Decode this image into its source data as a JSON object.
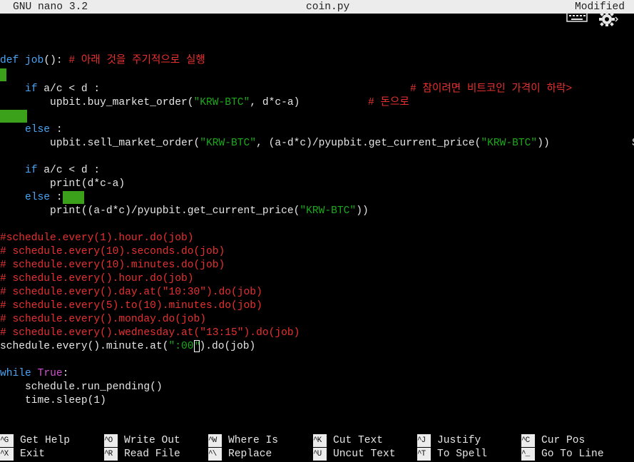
{
  "titlebar": {
    "app": "GNU nano 3.2",
    "file": "coin.py",
    "status": "Modified"
  },
  "tray_icons": [
    "keyboard-icon",
    "gear-icon"
  ],
  "code": {
    "l1_kw": "def",
    "l1_fn": "job",
    "l1_rest": "(): ",
    "l1_cm": "# 아래 것을 주기적으로 실행",
    "l3_indent": "    ",
    "l3_kw": "if",
    "l3_rest": " a/c < d :",
    "l3_cm": "# 참이려면 비트코인 가격이 하락>",
    "l4_a": "        upbit.buy_market_order(",
    "l4_s": "\"KRW-BTC\"",
    "l4_b": ", d*c-a)",
    "l4_cm": "# 돈으로",
    "l6_kw": "else",
    "l6_rest": " :",
    "l7_a": "        upbit.sell_market_order(",
    "l7_s1": "\"KRW-BTC\"",
    "l7_b": ", (a-d*c)/pyupbit.get_current_price(",
    "l7_s2": "\"KRW-BTC\"",
    "l7_c": "))",
    "l7_tail": "S",
    "l9_kw": "if",
    "l9_rest": " a/c < d :",
    "l10": "        print(d*c-a)",
    "l11_kw": "else",
    "l11_rest": " :",
    "l12_a": "        print((a-d*c)/pyupbit.get_current_price(",
    "l12_s": "\"KRW-BTC\"",
    "l12_b": "))",
    "comments": [
      "#schedule.every(1).hour.do(job)",
      "# schedule.every(10).seconds.do(job)",
      "# schedule.every(10).minutes.do(job)",
      "# schedule.every().hour.do(job)",
      "# schedule.every().day.at(\"10:30\").do(job)",
      "# schedule.every(5).to(10).minutes.do(job)",
      "# schedule.every().monday.do(job)",
      "# schedule.every().wednesday.at(\"13:15\").do(job)"
    ],
    "l22_a": "schedule.every().minute.at(",
    "l22_s1": "\":00",
    "l22_cur": "\"",
    "l22_b": ").do(job)",
    "l24_kw": "while",
    "l24_true": "True",
    "l24_rest": ":",
    "l25": "    schedule.run_pending()",
    "l26": "    time.sleep(1)"
  },
  "shortcuts": [
    {
      "key": "^G",
      "label": "Get Help"
    },
    {
      "key": "^O",
      "label": "Write Out"
    },
    {
      "key": "^W",
      "label": "Where Is"
    },
    {
      "key": "^K",
      "label": "Cut Text"
    },
    {
      "key": "^J",
      "label": "Justify"
    },
    {
      "key": "^C",
      "label": "Cur Pos"
    },
    {
      "key": "^X",
      "label": "Exit"
    },
    {
      "key": "^R",
      "label": "Read File"
    },
    {
      "key": "^\\",
      "label": "Replace"
    },
    {
      "key": "^U",
      "label": "Uncut Text"
    },
    {
      "key": "^T",
      "label": "To Spell"
    },
    {
      "key": "^_",
      "label": "Go To Line"
    }
  ]
}
